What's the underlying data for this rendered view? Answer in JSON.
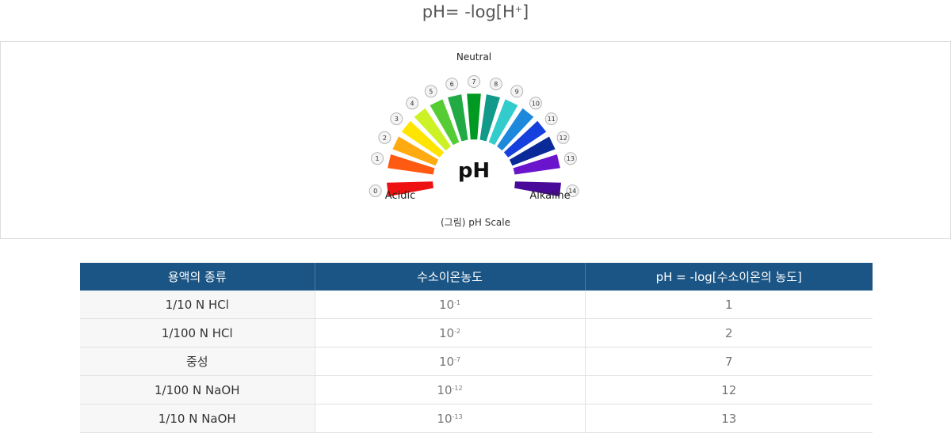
{
  "formula": {
    "base": "pH= -log[H",
    "sup": "+",
    "close": "]"
  },
  "figure": {
    "center_label": "pH",
    "neutral_label": "Neutral",
    "acidic_label": "Acidic",
    "alkaline_label": "Alkaline",
    "caption": "(그림) pH Scale",
    "scale": [
      {
        "ph": "0",
        "color": "#ee1111"
      },
      {
        "ph": "1",
        "color": "#ff5a12"
      },
      {
        "ph": "2",
        "color": "#ffaa11"
      },
      {
        "ph": "3",
        "color": "#ffe400"
      },
      {
        "ph": "4",
        "color": "#ccf226"
      },
      {
        "ph": "5",
        "color": "#55cc33"
      },
      {
        "ph": "6",
        "color": "#22aa44"
      },
      {
        "ph": "7",
        "color": "#009a22"
      },
      {
        "ph": "8",
        "color": "#119a8a"
      },
      {
        "ph": "9",
        "color": "#33cccc"
      },
      {
        "ph": "10",
        "color": "#1e88dd"
      },
      {
        "ph": "11",
        "color": "#1540dd"
      },
      {
        "ph": "12",
        "color": "#0a2a99"
      },
      {
        "ph": "13",
        "color": "#6a15cc"
      },
      {
        "ph": "14",
        "color": "#4a0a99"
      }
    ]
  },
  "table": {
    "headers": [
      "용액의 종류",
      "수소이온농도",
      "pH = -log[수소이온의 농도]"
    ],
    "rows": [
      {
        "type": "1/10 N HCl",
        "conc_base": "10",
        "conc_exp": "-1",
        "ph": "1"
      },
      {
        "type": "1/100 N HCl",
        "conc_base": "10",
        "conc_exp": "-2",
        "ph": "2"
      },
      {
        "type": "중성",
        "conc_base": "10",
        "conc_exp": "-7",
        "ph": "7"
      },
      {
        "type": "1/100 N NaOH",
        "conc_base": "10",
        "conc_exp": "-12",
        "ph": "12"
      },
      {
        "type": "1/10 N NaOH",
        "conc_base": "10",
        "conc_exp": "-13",
        "ph": "13"
      }
    ]
  },
  "colors": {
    "header_bg": "#1b5585"
  }
}
